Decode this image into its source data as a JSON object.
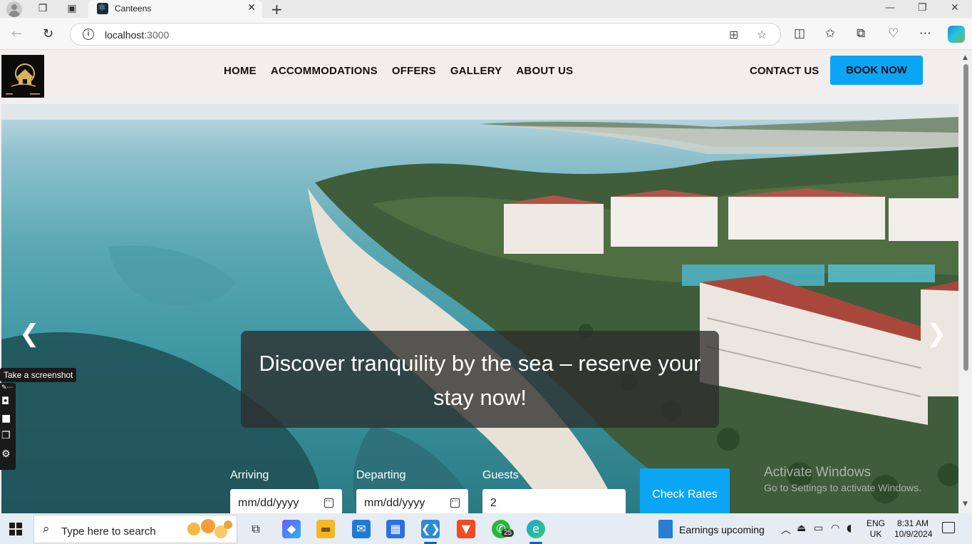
{
  "browser": {
    "tab_title": "Canteens",
    "new_tab": "+",
    "url_host": "localhost",
    "url_port": ":3000"
  },
  "site": {
    "nav": [
      "HOME",
      "ACCOMMODATIONS",
      "OFFERS",
      "GALLERY",
      "ABOUT US"
    ],
    "contact_label": "CONTACT US",
    "book_label": "BOOK NOW",
    "hero_caption": "Discover tranquility by the sea – reserve your stay now!",
    "prev_arrow": "❮",
    "next_arrow": "❯",
    "booking": {
      "arriving_label": "Arriving",
      "arriving_placeholder": "mm/dd/yyyy",
      "departing_label": "Departing",
      "departing_placeholder": "mm/dd/yyyy",
      "guests_label": "Guests",
      "guests_value": "2",
      "check_rates_label": "Check Rates"
    },
    "colors": {
      "accent": "#0aa6f5",
      "header_bg": "#f3eeee"
    }
  },
  "screenshot_tool": {
    "tooltip": "Take a screenshot"
  },
  "watermark": {
    "line1": "Activate Windows",
    "line2": "Go to Settings to activate Windows."
  },
  "taskbar": {
    "search_placeholder": "Type here to search",
    "whatsapp_badge": "25",
    "news_text": "Earnings upcoming",
    "lang_line1": "ENG",
    "lang_line2": "UK",
    "time": "8:31 AM",
    "date": "10/9/2024"
  }
}
